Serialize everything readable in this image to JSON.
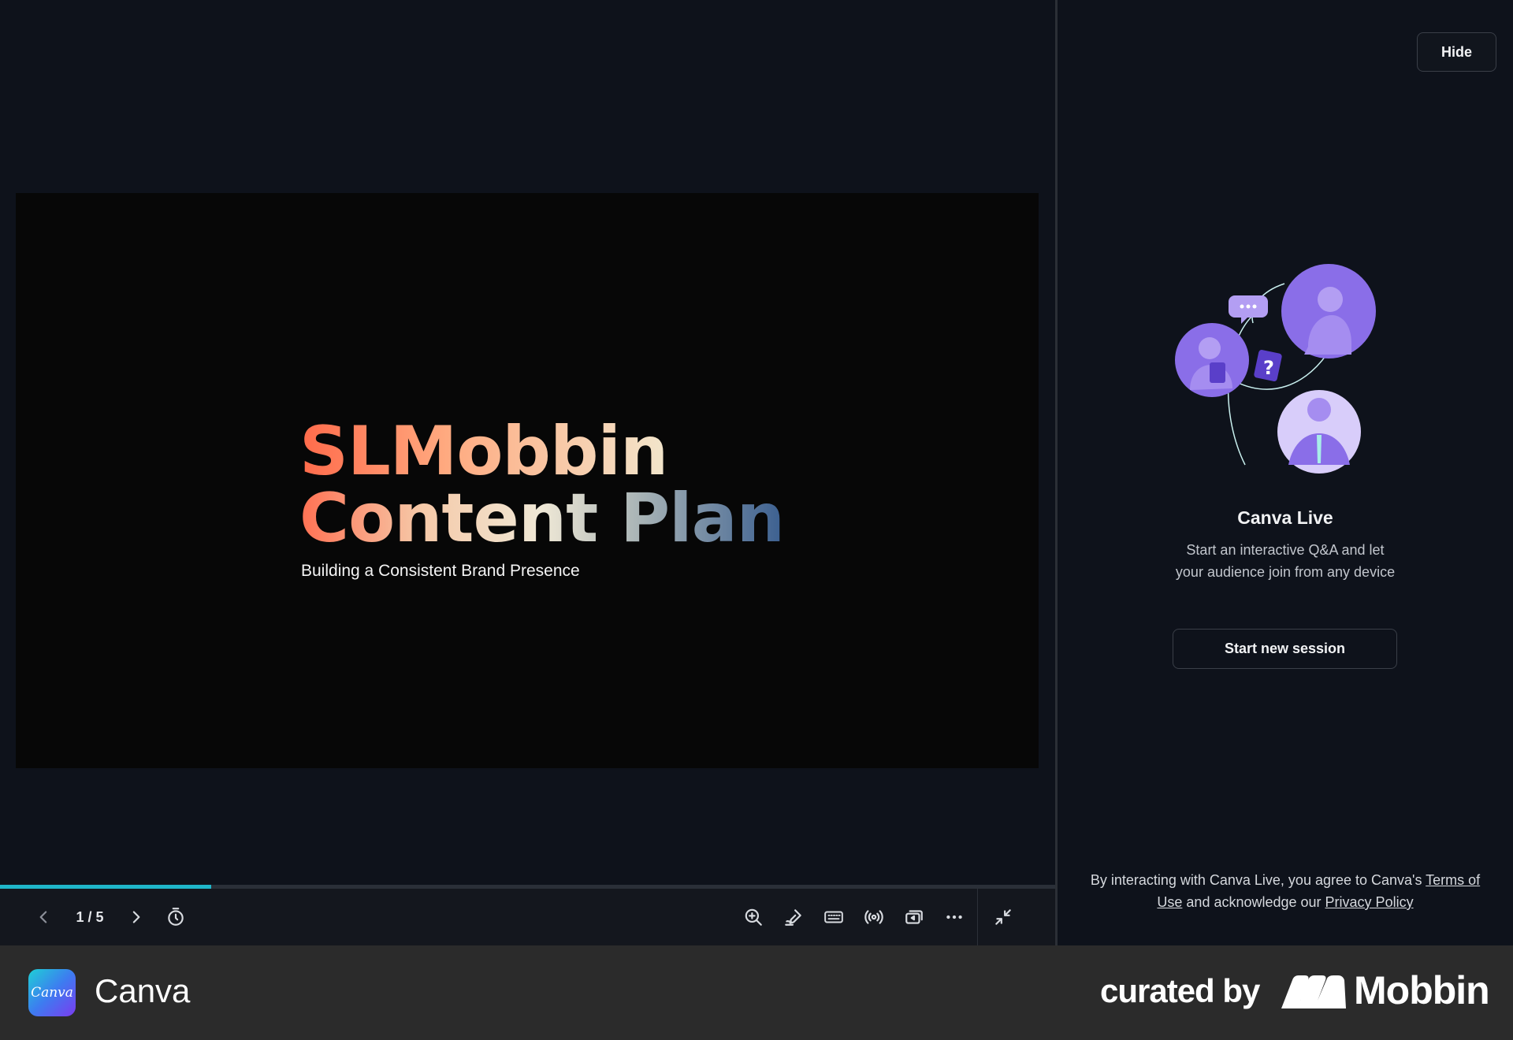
{
  "slide": {
    "title_line1_part1": "SLMobbin",
    "title_line2_part1": "Content",
    "title_line2_part2": "Plan",
    "subtitle": "Building a Consistent Brand Presence"
  },
  "controls": {
    "page_indicator": "1 / 5",
    "progress_fraction": 0.2
  },
  "panel": {
    "hide_label": "Hide",
    "live_title": "Canva Live",
    "live_description": "Start an interactive Q&A and let your audience join from any device",
    "start_label": "Start new session",
    "legal_prefix": "By interacting with Canva Live, you agree to Canva's ",
    "terms_link": "Terms of Use",
    "legal_middle": " and acknowledge our ",
    "privacy_link": "Privacy Policy"
  },
  "footer": {
    "logo_text": "Canva",
    "app_name": "Canva",
    "curated_by": "curated by",
    "brand": "Mobbin"
  },
  "icons": [
    "chevron-left-icon",
    "chevron-right-icon",
    "timer-icon",
    "zoom-in-icon",
    "draw-icon",
    "keyboard-icon",
    "broadcast-icon",
    "presenter-view-icon",
    "more-icon",
    "minimize-icon"
  ],
  "colors": {
    "accent_progress": "#1fb6c9",
    "panel_bg": "#0e121b",
    "illustration_purple": "#8a6ee8"
  }
}
